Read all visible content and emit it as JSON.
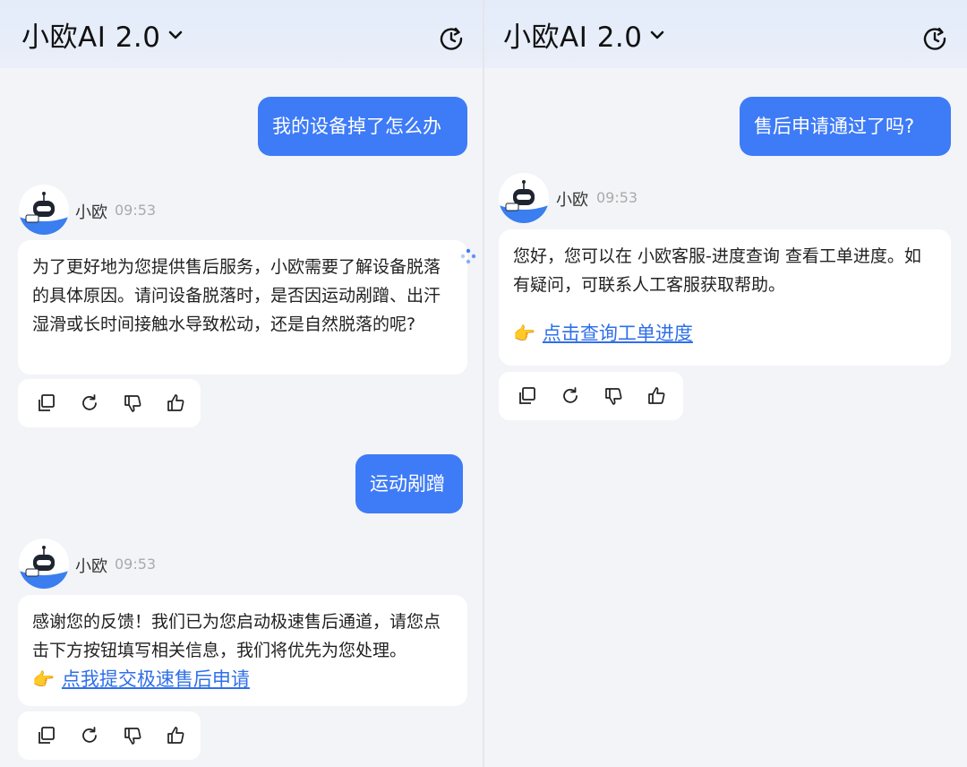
{
  "left": {
    "header": {
      "title": "小欧AI 2.0"
    },
    "messages": [
      {
        "role": "user",
        "text": "我的设备掉了怎么办"
      },
      {
        "role": "bot",
        "name": "小欧",
        "time": "09:53",
        "text": "为了更好地为您提供售后服务，小欧需要了解设备脱落的具体原因。请问设备脱落时，是否因运动剐蹭、出汗湿滑或长时间接触水导致松动，还是自然脱落的呢?"
      },
      {
        "role": "user",
        "text": "运动剐蹭"
      },
      {
        "role": "bot",
        "name": "小欧",
        "time": "09:53",
        "text": "感谢您的反馈！我们已为您启动极速售后通道，请您点击下方按钮填写相关信息，我们将优先为您处理。",
        "link_icon": "👉",
        "link_text": "点我提交极速售后申请"
      }
    ]
  },
  "right": {
    "header": {
      "title": "小欧AI 2.0"
    },
    "messages": [
      {
        "role": "user",
        "text": "售后申请通过了吗?"
      },
      {
        "role": "bot",
        "name": "小欧",
        "time": "09:53",
        "text": "您好，您可以在 小欧客服-进度查询 查看工单进度。如有疑问，可联系人工客服获取帮助。",
        "link_icon": "👉",
        "link_text": "点击查询工单进度"
      }
    ]
  },
  "icons": {
    "history": "history-icon",
    "copy": "copy-icon",
    "regenerate": "refresh-icon",
    "dislike": "thumbs-down-icon",
    "like": "thumbs-up-icon",
    "avatar": "robot-avatar-icon"
  },
  "colors": {
    "accent": "#3e7bf7",
    "link": "#2f6fea",
    "header_bg": "#e4ecfa",
    "background": "#f3f4f7"
  }
}
